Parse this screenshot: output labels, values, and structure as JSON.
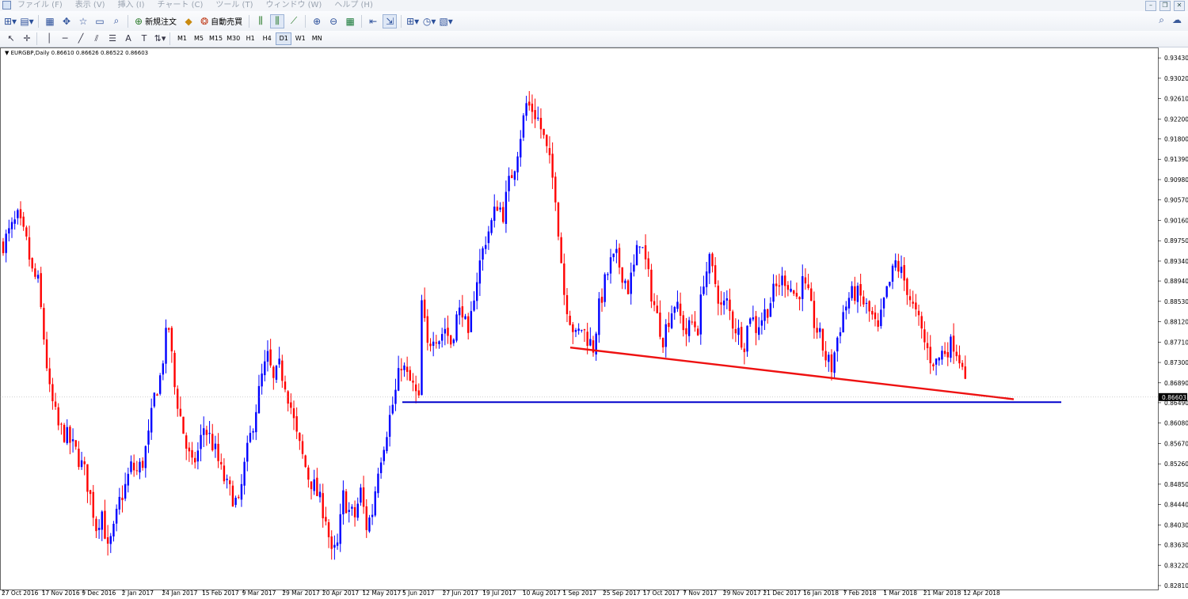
{
  "menu": {
    "items": [
      "ファイル (F)",
      "表示 (V)",
      "挿入 (I)",
      "チャート (C)",
      "ツール (T)",
      "ウィンドウ (W)",
      "ヘルプ (H)"
    ]
  },
  "toolbar": {
    "new_order_label": "新規注文",
    "auto_trading_label": "自動売買",
    "icons": [
      "new-chart-icon",
      "profiles-icon",
      "market-watch-icon",
      "navigator-icon",
      "data-window-icon",
      "terminal-icon",
      "tester-icon",
      "metaeditor-icon",
      "bar-chart-icon",
      "candlestick-icon",
      "line-chart-icon",
      "zoom-in-icon",
      "zoom-out-icon",
      "tile-windows-icon",
      "chart-shift-icon",
      "auto-scroll-icon",
      "indicators-icon",
      "periods-icon",
      "templates-icon"
    ]
  },
  "timeframes": [
    "M1",
    "M5",
    "M15",
    "M30",
    "H1",
    "H4",
    "D1",
    "W1",
    "MN"
  ],
  "active_timeframe": "D1",
  "chart": {
    "header": "EURGBP,Daily  0.86610 0.86626 0.86522 0.86603",
    "current_price_label": "0.86603"
  },
  "chart_data": {
    "type": "candlestick",
    "symbol": "EURGBP",
    "period": "Daily",
    "ohlc_last": {
      "open": 0.8661,
      "high": 0.86626,
      "low": 0.86522,
      "close": 0.86603
    },
    "ylim": [
      0.8281,
      0.9348
    ],
    "y_ticks": [
      "0.93430",
      "0.93020",
      "0.92610",
      "0.92200",
      "0.91800",
      "0.91390",
      "0.90980",
      "0.90570",
      "0.90160",
      "0.89750",
      "0.89340",
      "0.88940",
      "0.88530",
      "0.88120",
      "0.87710",
      "0.87300",
      "0.86890",
      "0.86490",
      "0.86080",
      "0.85670",
      "0.85260",
      "0.84850",
      "0.84440",
      "0.84030",
      "0.83630",
      "0.83220",
      "0.82810"
    ],
    "x_ticks": [
      "27 Oct 2016",
      "17 Nov 2016",
      "9 Dec 2016",
      "2 Jan 2017",
      "24 Jan 2017",
      "15 Feb 2017",
      "9 Mar 2017",
      "29 Mar 2017",
      "20 Apr 2017",
      "12 May 2017",
      "5 Jun 2017",
      "27 Jun 2017",
      "19 Jul 2017",
      "10 Aug 2017",
      "1 Sep 2017",
      "25 Sep 2017",
      "17 Oct 2017",
      "7 Nov 2017",
      "29 Nov 2017",
      "21 Dec 2017",
      "16 Jan 2018",
      "7 Feb 2018",
      "1 Mar 2018",
      "21 Mar 2018",
      "12 Apr 2018"
    ],
    "price_path": [
      [
        0,
        0.897
      ],
      [
        3,
        0.9
      ],
      [
        5,
        0.902
      ],
      [
        8,
        0.897
      ],
      [
        10,
        0.891
      ],
      [
        12,
        0.889
      ],
      [
        14,
        0.878
      ],
      [
        16,
        0.867
      ],
      [
        19,
        0.86
      ],
      [
        22,
        0.858
      ],
      [
        25,
        0.855
      ],
      [
        28,
        0.851
      ],
      [
        30,
        0.846
      ],
      [
        32,
        0.84
      ],
      [
        34,
        0.843
      ],
      [
        36,
        0.835
      ],
      [
        38,
        0.839
      ],
      [
        40,
        0.845
      ],
      [
        42,
        0.848
      ],
      [
        44,
        0.852
      ],
      [
        46,
        0.851
      ],
      [
        48,
        0.853
      ],
      [
        50,
        0.858
      ],
      [
        52,
        0.866
      ],
      [
        54,
        0.87
      ],
      [
        56,
        0.878
      ],
      [
        57,
        0.88
      ],
      [
        59,
        0.868
      ],
      [
        61,
        0.862
      ],
      [
        63,
        0.856
      ],
      [
        65,
        0.852
      ],
      [
        67,
        0.855
      ],
      [
        69,
        0.86
      ],
      [
        71,
        0.858
      ],
      [
        73,
        0.855
      ],
      [
        75,
        0.851
      ],
      [
        77,
        0.848
      ],
      [
        79,
        0.846
      ],
      [
        81,
        0.844
      ],
      [
        83,
        0.852
      ],
      [
        85,
        0.858
      ],
      [
        87,
        0.864
      ],
      [
        89,
        0.87
      ],
      [
        91,
        0.874
      ],
      [
        93,
        0.869
      ],
      [
        95,
        0.872
      ],
      [
        97,
        0.869
      ],
      [
        99,
        0.864
      ],
      [
        101,
        0.858
      ],
      [
        103,
        0.854
      ],
      [
        105,
        0.85
      ],
      [
        107,
        0.848
      ],
      [
        109,
        0.845
      ],
      [
        111,
        0.842
      ],
      [
        113,
        0.834
      ],
      [
        115,
        0.836
      ],
      [
        117,
        0.846
      ],
      [
        119,
        0.843
      ],
      [
        121,
        0.842
      ],
      [
        123,
        0.847
      ],
      [
        125,
        0.84
      ],
      [
        127,
        0.843
      ],
      [
        129,
        0.852
      ],
      [
        131,
        0.857
      ],
      [
        133,
        0.862
      ],
      [
        135,
        0.867
      ],
      [
        137,
        0.873
      ],
      [
        139,
        0.87
      ],
      [
        141,
        0.868
      ],
      [
        143,
        0.865
      ],
      [
        144,
        0.885
      ],
      [
        146,
        0.876
      ],
      [
        148,
        0.879
      ],
      [
        150,
        0.878
      ],
      [
        152,
        0.88
      ],
      [
        154,
        0.877
      ],
      [
        156,
        0.882
      ],
      [
        158,
        0.884
      ],
      [
        160,
        0.877
      ],
      [
        162,
        0.887
      ],
      [
        164,
        0.893
      ],
      [
        166,
        0.898
      ],
      [
        168,
        0.901
      ],
      [
        170,
        0.905
      ],
      [
        172,
        0.903
      ],
      [
        174,
        0.909
      ],
      [
        176,
        0.913
      ],
      [
        178,
        0.919
      ],
      [
        180,
        0.925
      ],
      [
        182,
        0.924
      ],
      [
        184,
        0.922
      ],
      [
        186,
        0.918
      ],
      [
        188,
        0.913
      ],
      [
        190,
        0.907
      ],
      [
        191,
        0.9
      ],
      [
        193,
        0.887
      ],
      [
        195,
        0.882
      ],
      [
        197,
        0.878
      ],
      [
        199,
        0.88
      ],
      [
        201,
        0.878
      ],
      [
        203,
        0.876
      ],
      [
        205,
        0.884
      ],
      [
        207,
        0.889
      ],
      [
        209,
        0.893
      ],
      [
        211,
        0.894
      ],
      [
        213,
        0.891
      ],
      [
        215,
        0.888
      ],
      [
        217,
        0.892
      ],
      [
        219,
        0.898
      ],
      [
        221,
        0.893
      ],
      [
        223,
        0.887
      ],
      [
        225,
        0.882
      ],
      [
        227,
        0.878
      ],
      [
        229,
        0.882
      ],
      [
        231,
        0.885
      ],
      [
        233,
        0.882
      ],
      [
        235,
        0.879
      ],
      [
        237,
        0.881
      ],
      [
        239,
        0.88
      ],
      [
        241,
        0.89
      ],
      [
        243,
        0.893
      ],
      [
        245,
        0.889
      ],
      [
        247,
        0.884
      ],
      [
        249,
        0.885
      ],
      [
        251,
        0.881
      ],
      [
        253,
        0.879
      ],
      [
        255,
        0.877
      ],
      [
        257,
        0.883
      ],
      [
        259,
        0.88
      ],
      [
        261,
        0.882
      ],
      [
        263,
        0.884
      ],
      [
        265,
        0.887
      ],
      [
        267,
        0.889
      ],
      [
        269,
        0.89
      ],
      [
        271,
        0.888
      ],
      [
        273,
        0.886
      ],
      [
        275,
        0.889
      ],
      [
        277,
        0.886
      ],
      [
        279,
        0.881
      ],
      [
        281,
        0.878
      ],
      [
        283,
        0.874
      ],
      [
        285,
        0.872
      ],
      [
        287,
        0.878
      ],
      [
        289,
        0.883
      ],
      [
        291,
        0.886
      ],
      [
        293,
        0.887
      ],
      [
        295,
        0.886
      ],
      [
        297,
        0.884
      ],
      [
        299,
        0.882
      ],
      [
        301,
        0.879
      ],
      [
        303,
        0.885
      ],
      [
        305,
        0.889
      ],
      [
        307,
        0.893
      ],
      [
        309,
        0.891
      ],
      [
        311,
        0.888
      ],
      [
        313,
        0.884
      ],
      [
        315,
        0.881
      ],
      [
        317,
        0.877
      ],
      [
        319,
        0.874
      ],
      [
        321,
        0.873
      ],
      [
        323,
        0.875
      ],
      [
        325,
        0.876
      ],
      [
        327,
        0.877
      ],
      [
        329,
        0.874
      ],
      [
        330,
        0.874
      ],
      [
        331,
        0.868
      ]
    ],
    "annotations": [
      {
        "type": "trendline",
        "color": "#ee1111",
        "from": [
          "1 Sep 2017",
          0.876
        ],
        "to": [
          "12 Apr 2018",
          0.8656
        ]
      },
      {
        "type": "horizontal_line",
        "color": "#0000cc",
        "value": 0.865
      }
    ],
    "bull_color": "#0000ff",
    "bear_color": "#ff0000"
  }
}
